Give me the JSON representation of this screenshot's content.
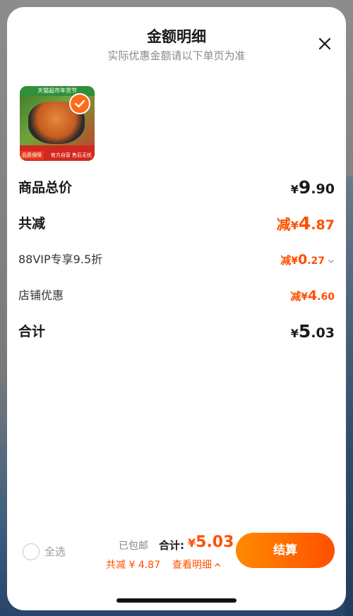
{
  "header": {
    "title": "金额明细",
    "subtitle": "实际优惠金额请以下单页为准"
  },
  "product": {
    "image_alt": "铸铁锅商品图",
    "top_text": "天猫超市年货节",
    "tag_text": "品质保障",
    "badge_text": "官方自营 售后无忧",
    "selected": true
  },
  "rows": {
    "subtotal": {
      "label": "商品总价",
      "currency": "¥",
      "amount_int": "9",
      "amount_dec": ".90"
    },
    "total_reduction": {
      "label": "共减",
      "prefix": "减",
      "currency": "¥",
      "amount_int": "4",
      "amount_dec": ".87"
    },
    "vip_discount": {
      "label": "88VIP专享9.5折",
      "prefix": "减",
      "currency": "¥",
      "amount_int": "0",
      "amount_dec": ".27"
    },
    "shop_discount": {
      "label": "店铺优惠",
      "prefix": "减",
      "currency": "¥",
      "amount_int": "4",
      "amount_dec": ".60"
    },
    "total": {
      "label": "合计",
      "currency": "¥",
      "amount_int": "5",
      "amount_dec": ".03"
    }
  },
  "bottom_bar": {
    "select_all_label": "全选",
    "shipping_text": "已包邮",
    "total_label": "合计:",
    "total_currency": "¥",
    "total_amount": "5.03",
    "reduce_text": "共减 ¥ 4.87",
    "detail_link": "查看明细",
    "checkout_label": "结算"
  },
  "colors": {
    "accent": "#ff5000",
    "accent_gradient_start": "#ff8a00",
    "text_primary": "#1a1a1a",
    "text_secondary": "#8a8a8a"
  },
  "icons": {
    "close": "close-icon",
    "check": "check-icon",
    "chevron_down": "chevron-down-icon",
    "chevron_up": "chevron-up-icon"
  }
}
